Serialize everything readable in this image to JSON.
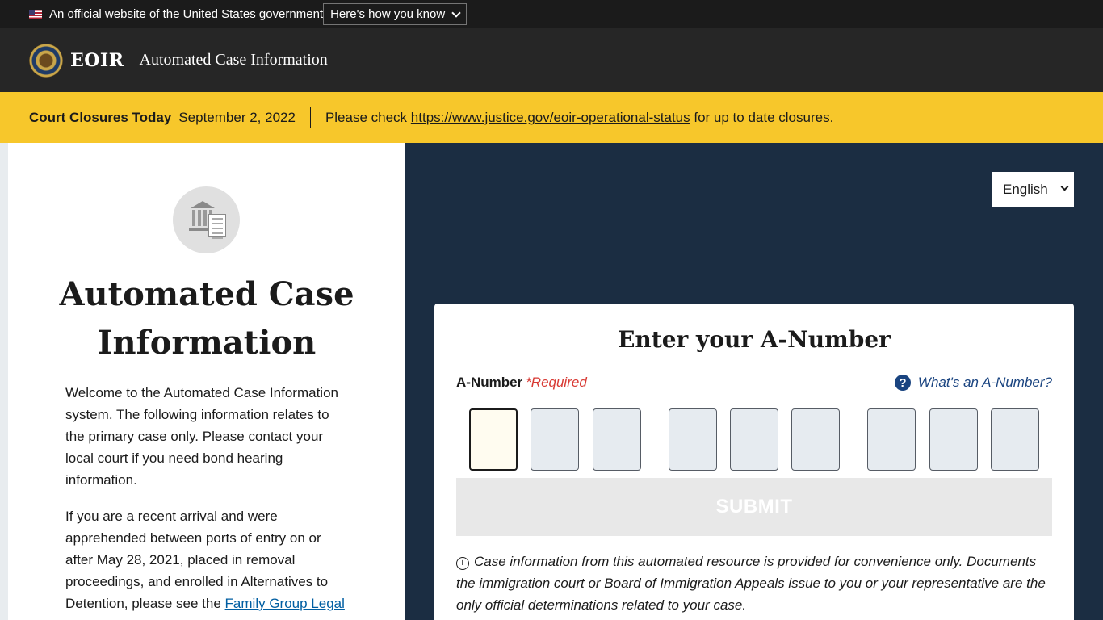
{
  "gov_banner": {
    "text": "An official website of the United States government",
    "how_label": "Here's how you know"
  },
  "header": {
    "brand": "EOIR",
    "title": "Automated Case Information"
  },
  "alert": {
    "title": "Court Closures Today",
    "date": "September 2, 2022",
    "prefix": "Please check",
    "link": "https://www.justice.gov/eoir-operational-status",
    "suffix": "for up to date closures."
  },
  "left": {
    "heading": "Automated Case Information",
    "para1": "Welcome to the Automated Case Information system. The following information relates to the primary case only. Please contact your local court if you need bond hearing information.",
    "para2_text": "If you are a recent arrival and were apprehended between ports of entry on or after May 28, 2021, placed in removal proceedings, and enrolled in Alternatives to Detention, please see the",
    "para2_link": "Family Group Legal"
  },
  "language": {
    "selected": "English"
  },
  "card": {
    "title": "Enter your A-Number",
    "label": "A-Number",
    "required": "*Required",
    "help": "What's an A-Number?",
    "submit": "SUBMIT",
    "note": "Case information from this automated resource is provided for convenience only. Documents the immigration court or Board of Immigration Appeals issue to you or your representative are the only official determinations related to your case."
  },
  "icons": [
    "us-flag-icon",
    "chevron-down-icon",
    "doj-seal-icon",
    "courthouse-icon",
    "question-icon",
    "info-icon"
  ]
}
